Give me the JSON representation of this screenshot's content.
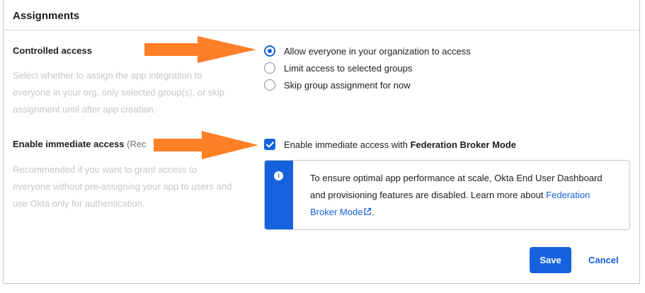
{
  "section": {
    "title": "Assignments"
  },
  "controlled_access": {
    "label": "Controlled access",
    "help": "Select whether to assign the app integration to everyone in your org, only selected group(s), or skip assignment until after app creation.",
    "options": [
      {
        "label": "Allow everyone in your organization to access",
        "selected": true
      },
      {
        "label": "Limit access to selected groups",
        "selected": false
      },
      {
        "label": "Skip group assignment for now",
        "selected": false
      }
    ]
  },
  "immediate_access": {
    "label": "Enable immediate access",
    "label_suffix": "(Rec",
    "help": "Recommended if you want to grant access to everyone without pre-assigning your app to users and use Okta only for authentication.",
    "checkbox_label": "Enable immediate access with ",
    "checkbox_label_bold": "Federation Broker Mode",
    "checked": true
  },
  "callout": {
    "text": "To ensure optimal app performance at scale, Okta End User Dashboard and provisioning features are disabled. Learn more about ",
    "link": "Federation Broker Mode",
    "after_link": "."
  },
  "buttons": {
    "save": "Save",
    "cancel": "Cancel"
  },
  "colors": {
    "accent": "#1662dd",
    "annotation_arrow": "#ff7f27"
  }
}
